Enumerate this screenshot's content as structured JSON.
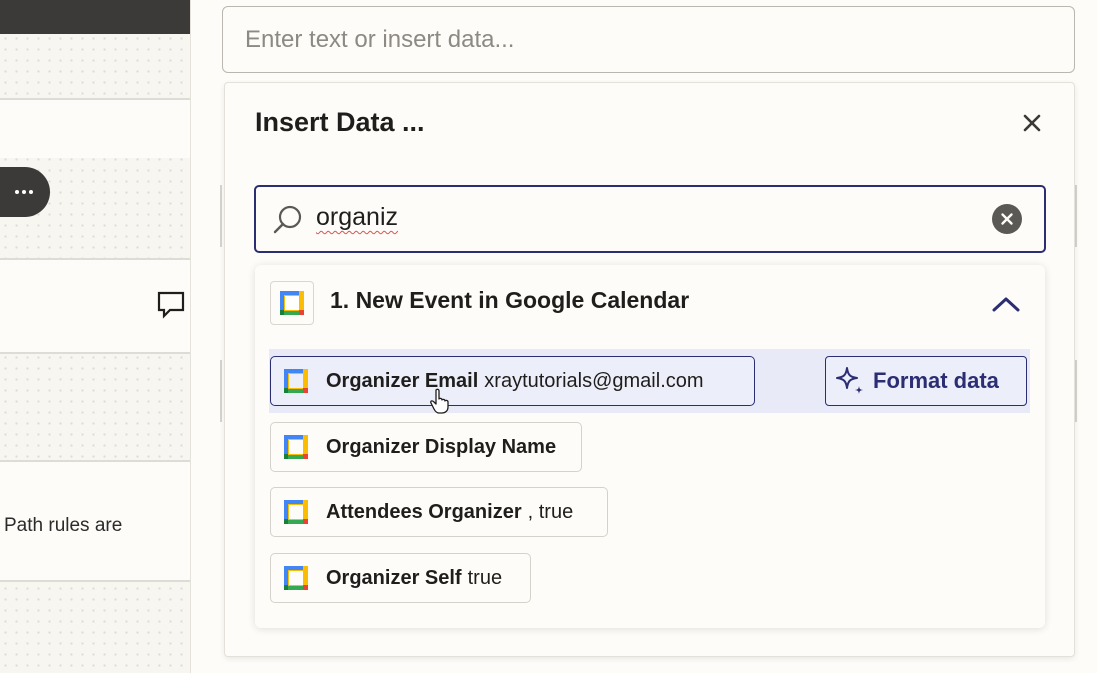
{
  "text_input": {
    "placeholder": "Enter text or insert data..."
  },
  "modal": {
    "title": "Insert Data ...",
    "search": {
      "value": "organiz"
    },
    "group": {
      "title": "1. New Event in Google Calendar",
      "items": [
        {
          "label": "Organizer Email",
          "value": "xraytutorials@gmail.com"
        },
        {
          "label": "Organizer Display Name",
          "value": ""
        },
        {
          "label": "Attendees Organizer",
          "value": ", true"
        },
        {
          "label": "Organizer Self",
          "value": "true"
        }
      ]
    },
    "format_button": {
      "label": "Format data"
    }
  },
  "left_panel": {
    "path_text": "Path rules are"
  },
  "icons": {
    "close": "close-icon",
    "search": "search-icon",
    "clear": "clear-icon",
    "app": "google-calendar-icon",
    "chevron": "chevron-up-icon",
    "sparkle": "sparkle-icon",
    "comment": "comment-icon",
    "more": "more-icon"
  },
  "colors": {
    "accent": "#2b2e73",
    "highlight": "#e9eaf7",
    "background": "#fdfcf8",
    "dark": "#3b3a38"
  }
}
